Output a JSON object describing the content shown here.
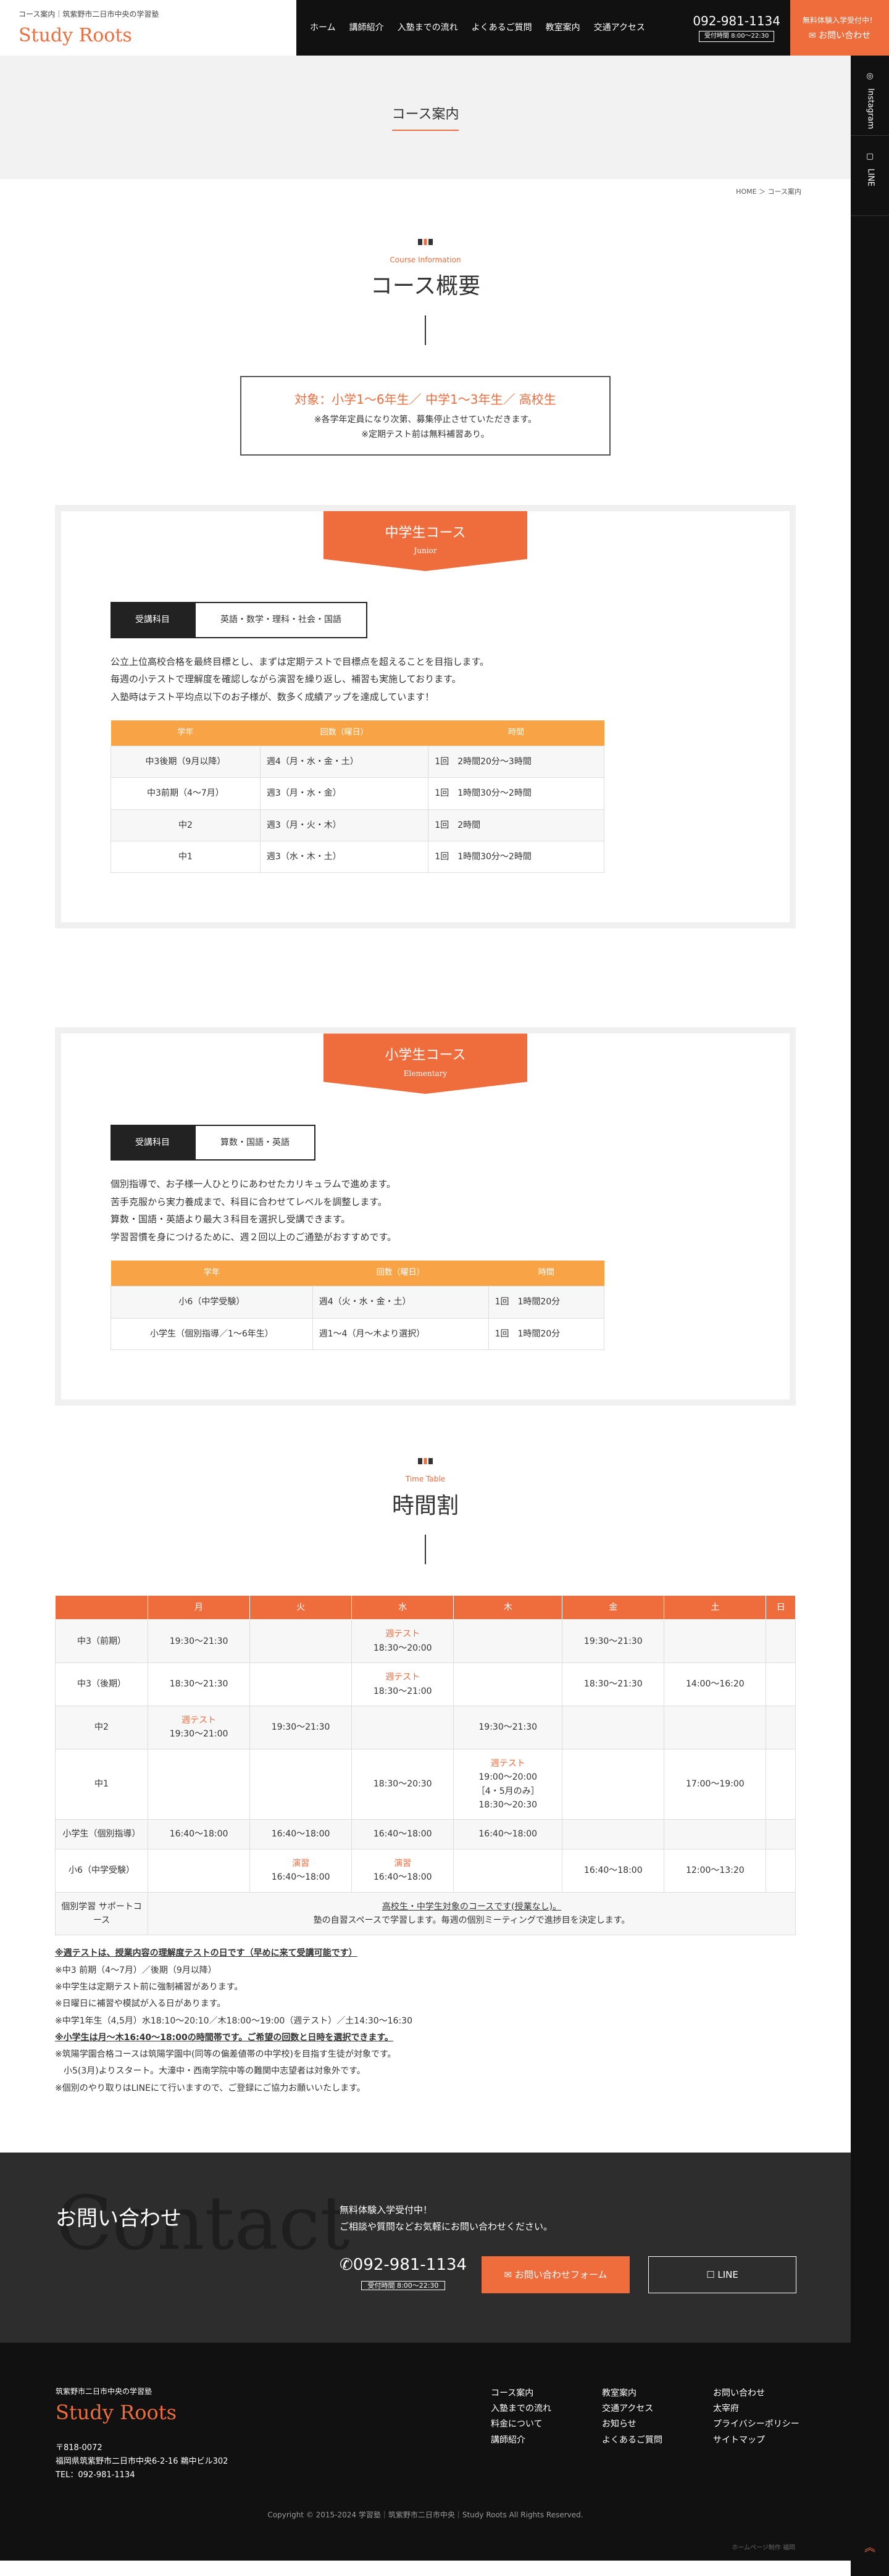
{
  "header": {
    "tagline": "コース案内｜筑紫野市二日市中央の学習塾",
    "logo": "Study Roots",
    "nav": [
      "ホーム",
      "講師紹介",
      "入塾までの流れ",
      "よくあるご質問",
      "教室案内",
      "交通アクセス"
    ],
    "tel": "092-981-1134",
    "hours": "受付時間 8:00〜22:30",
    "cta_small": "無料体験入学受付中！",
    "cta_big": "お問い合わせ"
  },
  "side": {
    "instagram": "Instagram",
    "line": "LINE"
  },
  "page_title": "コース案内",
  "breadcrumb": "HOME ＞ コース案内",
  "overview": {
    "en": "Course Information",
    "title": "コース概要",
    "target": "対象：小学1〜6年生／ 中学1〜3年生／ 高校生",
    "note1": "※各学年定員になり次第、募集停止させていただきます。",
    "note2": "※定期テスト前は無料補習あり。"
  },
  "junior": {
    "title": "中学生コース",
    "sub": "Junior",
    "subject_label": "受講科目",
    "subjects": "英語・数学・理科・社会・国語",
    "desc": [
      "公立上位高校合格を最終目標とし、まずは定期テストで目標点を超えることを目指します。",
      "毎週の小テストで理解度を確認しながら演習を繰り返し、補習も実施しております。",
      "入塾時はテスト平均点以下のお子様が、数多く成績アップを達成しています！"
    ],
    "head": [
      "学年",
      "回数（曜日）",
      "時間"
    ],
    "rows": [
      [
        "中3後期（9月以降）",
        "週4（月・水・金・土）",
        "1回　2時間20分〜3時間"
      ],
      [
        "中3前期（4〜7月）",
        "週3（月・水・金）",
        "1回　1時間30分〜2時間"
      ],
      [
        "中2",
        "週3（月・火・木）",
        "1回　2時間"
      ],
      [
        "中1",
        "週3（水・木・土）",
        "1回　1時間30分〜2時間"
      ]
    ]
  },
  "elementary": {
    "title": "小学生コース",
    "sub": "Elementary",
    "subject_label": "受講科目",
    "subjects": "算数・国語・英語",
    "desc": [
      "個別指導で、お子様一人ひとりにあわせたカリキュラムで進めます。",
      "苦手克服から実力養成まで、科目に合わせてレベルを調整します。",
      "算数・国語・英語より最大３科目を選択し受講できます。",
      "学習習慣を身につけるために、週２回以上のご通塾がおすすめです。"
    ],
    "head": [
      "学年",
      "回数（曜日）",
      "時間"
    ],
    "rows": [
      [
        "小6（中学受験）",
        "週4（火・水・金・土）",
        "1回　1時間20分"
      ],
      [
        "小学生（個別指導／1〜6年生）",
        "週1〜4（月〜木より選択）",
        "1回　1時間20分"
      ]
    ]
  },
  "timetable": {
    "en": "Time Table",
    "title": "時間割",
    "days": [
      "",
      "月",
      "火",
      "水",
      "木",
      "金",
      "土",
      "日"
    ],
    "rows": [
      [
        "中3（前期）",
        "19:30〜21:30",
        "",
        [
          "週テスト",
          "18:30〜20:00"
        ],
        "",
        "19:30〜21:30",
        "",
        ""
      ],
      [
        "中3（後期）",
        "18:30〜21:30",
        "",
        [
          "週テスト",
          "18:30〜21:00"
        ],
        "",
        "18:30〜21:30",
        "14:00〜16:20",
        ""
      ],
      [
        "中2",
        [
          "週テスト",
          "19:30〜21:00"
        ],
        "19:30〜21:30",
        "",
        "19:30〜21:30",
        "",
        "",
        ""
      ],
      [
        "中1",
        "",
        "",
        "18:30〜20:30",
        [
          "週テスト",
          "19:00〜20:00",
          "［4・5月のみ］",
          "18:30〜20:30"
        ],
        "",
        "17:00〜19:00",
        ""
      ],
      [
        "小学生（個別指導）",
        "16:40〜18:00",
        "16:40〜18:00",
        "16:40〜18:00",
        "16:40〜18:00",
        "",
        "",
        ""
      ],
      [
        "小6（中学受験）",
        "",
        [
          "演習",
          "16:40〜18:00"
        ],
        [
          "演習",
          "16:40〜18:00"
        ],
        "",
        "16:40〜18:00",
        "12:00〜13:20",
        ""
      ]
    ],
    "support_label": "個別学習 サポートコース",
    "support_1": "高校生・中学生対象のコースです(授業なし)。",
    "support_2": "塾の自習スペースで学習します。毎週の個別ミーティングで進捗目を決定します。"
  },
  "notes": [
    "※週テストは、授業内容の理解度テストの日です（早めに来て受講可能です）",
    "※中3 前期（4〜7月）／後期（9月以降）",
    "※中学生は定期テスト前に強制補習があります。",
    "※日曜日に補習や模試が入る日があります。",
    "※中学1年生（4,5月）水18:10〜20:10／木18:00〜19:00（週テスト）／土14:30〜16:30",
    "※小学生は月〜木16:40〜18:00の時間帯です。ご希望の回数と日時を選択できます。",
    "※筑陽学園合格コースは筑陽学園中(同等の偏差値帯の中学校)を目指す生徒が対象です。",
    "　小5(3月)よりスタート。大濠中・西南学院中等の難関中志望者は対象外です。",
    "※個別のやり取りはLINEにて行いますので、ご登録にご協力お願いいたします。"
  ],
  "contact": {
    "bg": "Contact",
    "title": "お問い合わせ",
    "msg1": "無料体験入学受付中！",
    "msg2": "ご相談や質問などお気軽にお問い合わせください。",
    "tel": "092-981-1134",
    "hours": "受付時間 8:00〜22:30",
    "form_btn": "お問い合わせフォーム",
    "line_btn": "LINE"
  },
  "footer": {
    "small": "筑紫野市二日市中央の学習塾",
    "name": "Study Roots",
    "addr": [
      "〒818-0072",
      "福岡県筑紫野市二日市中央6-2-16 鵜中ビル302",
      "TEL：092-981-1134"
    ],
    "links": [
      "コース案内",
      "教室案内",
      "お問い合わせ",
      "入塾までの流れ",
      "交通アクセス",
      "太宰府",
      "料金について",
      "お知らせ",
      "プライバシーポリシー",
      "講師紹介",
      "よくあるご質問",
      "サイトマップ"
    ],
    "copy": "Copyright © 2015-2024 学習塾｜筑紫野市二日市中央｜Study Roots All Rights Reserved.",
    "hp": "ホームページ制作 福岡"
  }
}
